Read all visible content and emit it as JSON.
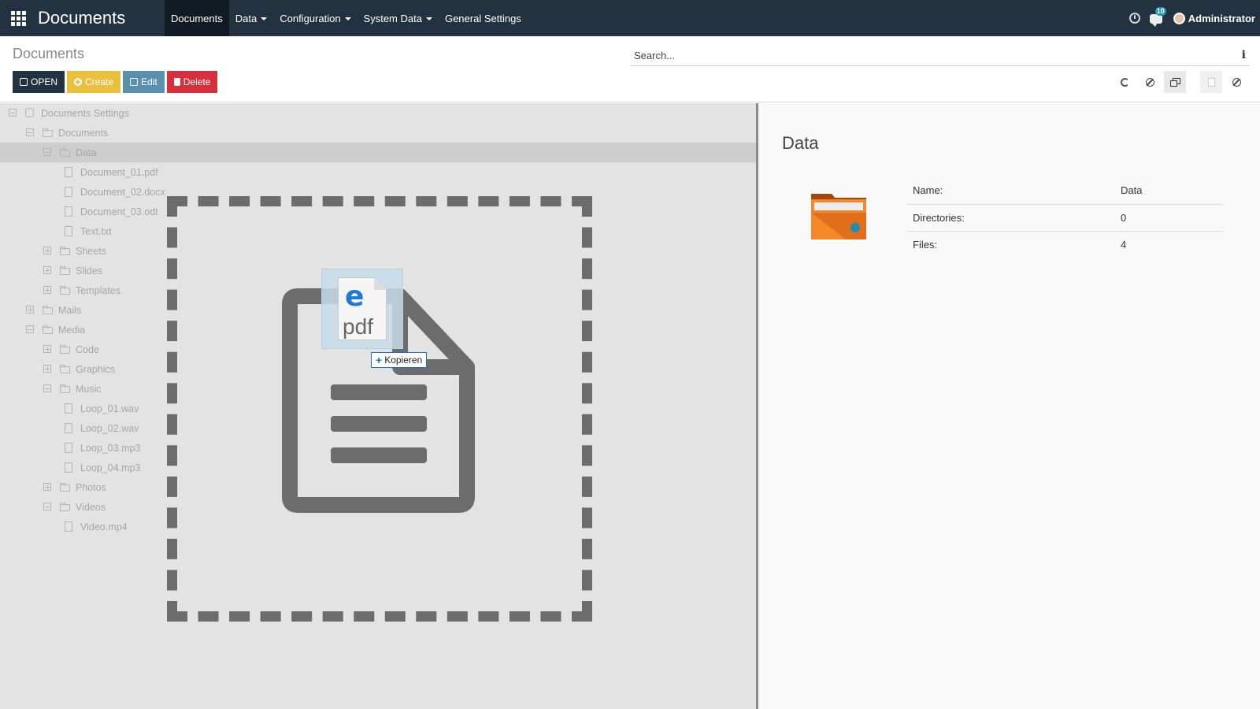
{
  "navbar": {
    "brand": "Documents",
    "menu": [
      {
        "label": "Documents",
        "active": true,
        "dropdown": false
      },
      {
        "label": "Data",
        "dropdown": true
      },
      {
        "label": "Configuration",
        "dropdown": true
      },
      {
        "label": "System Data",
        "dropdown": true
      },
      {
        "label": "General Settings",
        "dropdown": false
      }
    ],
    "notification_count": "10",
    "user_name": "Administrator"
  },
  "control": {
    "title": "Documents",
    "search_placeholder": "Search...",
    "buttons": {
      "open": "OPEN",
      "create": "Create",
      "edit": "Edit",
      "delete": "Delete"
    }
  },
  "tree": [
    {
      "label": "Documents Settings",
      "level": 0,
      "toggle": "minus",
      "icon": "database-icon"
    },
    {
      "label": "Documents",
      "level": 1,
      "toggle": "minus",
      "icon": "folder-open-icon"
    },
    {
      "label": "Data",
      "level": 2,
      "toggle": "minus",
      "icon": "folder-open-icon",
      "selected": true
    },
    {
      "label": "Document_01.pdf",
      "level": 3,
      "icon": "pdf-file-icon"
    },
    {
      "label": "Document_02.docx",
      "level": 3,
      "icon": "word-file-icon"
    },
    {
      "label": "Document_03.odt",
      "level": 3,
      "icon": "word-file-icon"
    },
    {
      "label": "Text.txt",
      "level": 3,
      "icon": "text-file-icon"
    },
    {
      "label": "Sheets",
      "level": 2,
      "toggle": "plus",
      "icon": "folder-icon"
    },
    {
      "label": "Slides",
      "level": 2,
      "toggle": "plus",
      "icon": "folder-icon"
    },
    {
      "label": "Templates",
      "level": 2,
      "toggle": "plus",
      "icon": "folder-icon"
    },
    {
      "label": "Mails",
      "level": 1,
      "toggle": "plus",
      "icon": "folder-icon"
    },
    {
      "label": "Media",
      "level": 1,
      "toggle": "minus",
      "icon": "folder-open-icon"
    },
    {
      "label": "Code",
      "level": 2,
      "toggle": "plus",
      "icon": "folder-icon"
    },
    {
      "label": "Graphics",
      "level": 2,
      "toggle": "plus",
      "icon": "folder-icon"
    },
    {
      "label": "Music",
      "level": 2,
      "toggle": "minus",
      "icon": "folder-open-icon"
    },
    {
      "label": "Loop_01.wav",
      "level": 3,
      "icon": "audio-file-icon"
    },
    {
      "label": "Loop_02.wav",
      "level": 3,
      "icon": "audio-file-icon"
    },
    {
      "label": "Loop_03.mp3",
      "level": 3,
      "icon": "audio-file-icon"
    },
    {
      "label": "Loop_04.mp3",
      "level": 3,
      "icon": "audio-file-icon"
    },
    {
      "label": "Photos",
      "level": 2,
      "toggle": "plus",
      "icon": "folder-icon"
    },
    {
      "label": "Videos",
      "level": 2,
      "toggle": "minus",
      "icon": "folder-open-icon"
    },
    {
      "label": "Video.mp4",
      "level": 3,
      "icon": "video-file-icon"
    }
  ],
  "drag": {
    "file_type_text": "pdf",
    "copy_label": "Kopieren"
  },
  "details": {
    "title": "Data",
    "rows": [
      {
        "key": "Name:",
        "value": "Data"
      },
      {
        "key": "Directories:",
        "value": "0"
      },
      {
        "key": "Files:",
        "value": "4"
      }
    ]
  },
  "colors": {
    "navbar_bg": "#233240",
    "open_button": "#233240",
    "create_button": "#e9c13e",
    "edit_button": "#5a8fae",
    "delete_button": "#d6303d",
    "folder_orange": "#f5892a",
    "edge_blue": "#1e7ad4"
  }
}
